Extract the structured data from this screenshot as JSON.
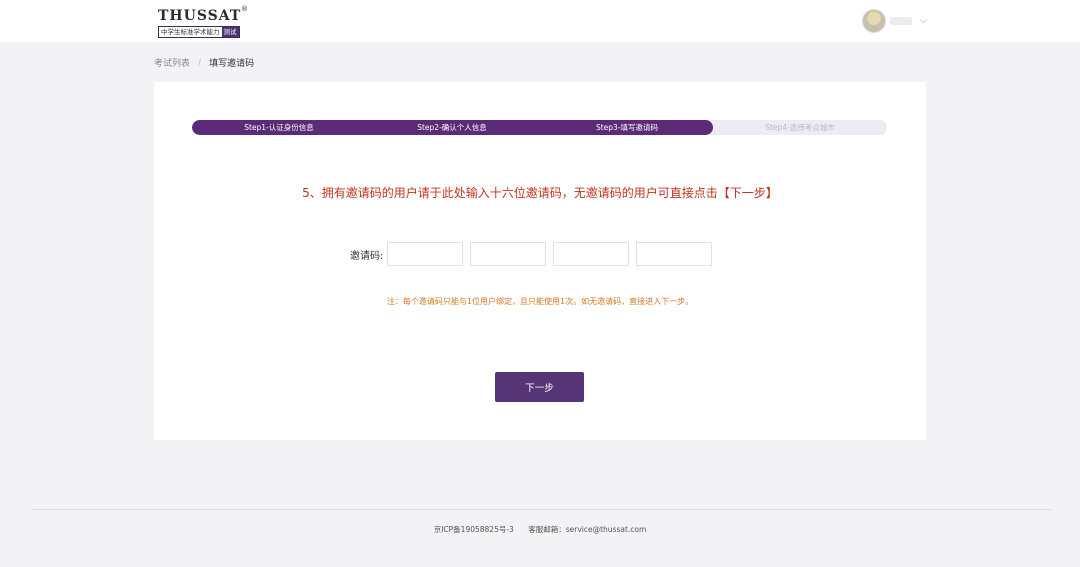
{
  "header": {
    "logo_main": "THUSSAT",
    "logo_reg": "®",
    "logo_sub": "中学生标准学术能力",
    "logo_badge": "测试",
    "user_caret": "⌵"
  },
  "breadcrumb": {
    "items": [
      "考试列表",
      "填写邀请码"
    ],
    "separator": "/"
  },
  "steps": {
    "items": [
      {
        "label": "Step1-认证身份信息",
        "active": true
      },
      {
        "label": "Step2-确认个人信息",
        "active": true
      },
      {
        "label": "Step3-填写邀请码",
        "active": true
      },
      {
        "label": "Step4-选择考点城市",
        "active": false
      }
    ],
    "progress": 0.75
  },
  "main": {
    "instruction": "5、拥有邀请码的用户请于此处输入十六位邀请码，无邀请码的用户可直接点击【下一步】",
    "code_label": "邀请码:",
    "code_values": [
      "",
      "",
      "",
      ""
    ],
    "note": "注：每个邀请码只能与1位用户绑定，且只能使用1次。如无邀请码，直接进入下一步。",
    "next_label": "下一步"
  },
  "footer": {
    "icp": "京ICP备19058825号-3",
    "service_label": "客服邮箱：",
    "service_email": "service@thussat.com"
  },
  "colors": {
    "accent": "#563576",
    "progress_fill": "#5b2b78",
    "instruction": "#c3311f",
    "note": "#d6782a"
  }
}
